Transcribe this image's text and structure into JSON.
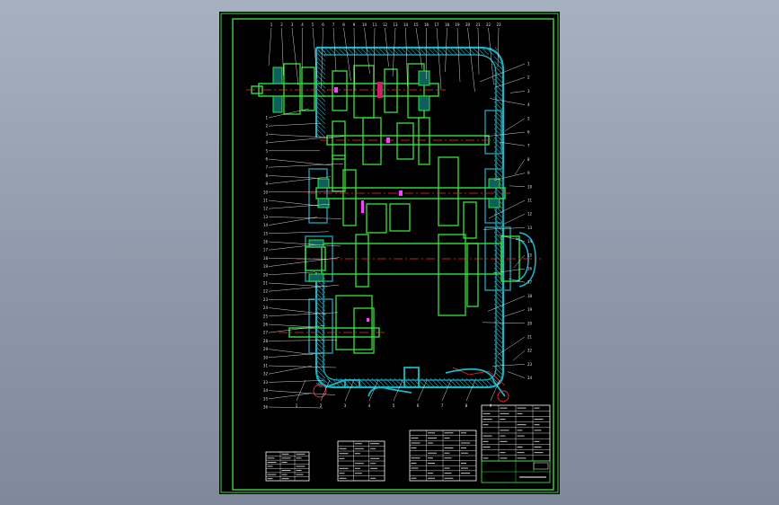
{
  "drawing": {
    "background": "#000000",
    "colors": {
      "frame": "#3fd93f",
      "housing": "#18b8c8",
      "hatch": "#1e8fa0",
      "shaft_outline": "#2fe23f",
      "axis": "#ff2a2a",
      "gear": "#36e536",
      "leader": "#e8e8e8",
      "accent": "#ff3cff",
      "table": "#ffffff"
    },
    "callouts_left": [
      "1",
      "2",
      "3",
      "4",
      "5",
      "6",
      "7",
      "8",
      "9",
      "10",
      "11",
      "12",
      "13",
      "14",
      "15",
      "16",
      "17",
      "18",
      "19",
      "20",
      "21",
      "22",
      "23",
      "24",
      "25",
      "26",
      "27",
      "28",
      "29",
      "30",
      "31",
      "32",
      "33",
      "34",
      "35",
      "36"
    ],
    "callouts_top": [
      "1",
      "2",
      "3",
      "4",
      "5",
      "6",
      "7",
      "8",
      "9",
      "10",
      "11",
      "12",
      "13",
      "14",
      "15",
      "16",
      "17",
      "18",
      "19",
      "20",
      "21",
      "22",
      "23"
    ],
    "callouts_right": [
      "1",
      "2",
      "3",
      "4",
      "5",
      "6",
      "7",
      "8",
      "9",
      "10",
      "11",
      "12",
      "13",
      "14",
      "15",
      "16",
      "17",
      "18",
      "19",
      "20",
      "21",
      "22",
      "23",
      "24"
    ],
    "callouts_bottom": [
      "1",
      "2",
      "3",
      "4",
      "5",
      "6",
      "7",
      "8",
      "9"
    ]
  }
}
